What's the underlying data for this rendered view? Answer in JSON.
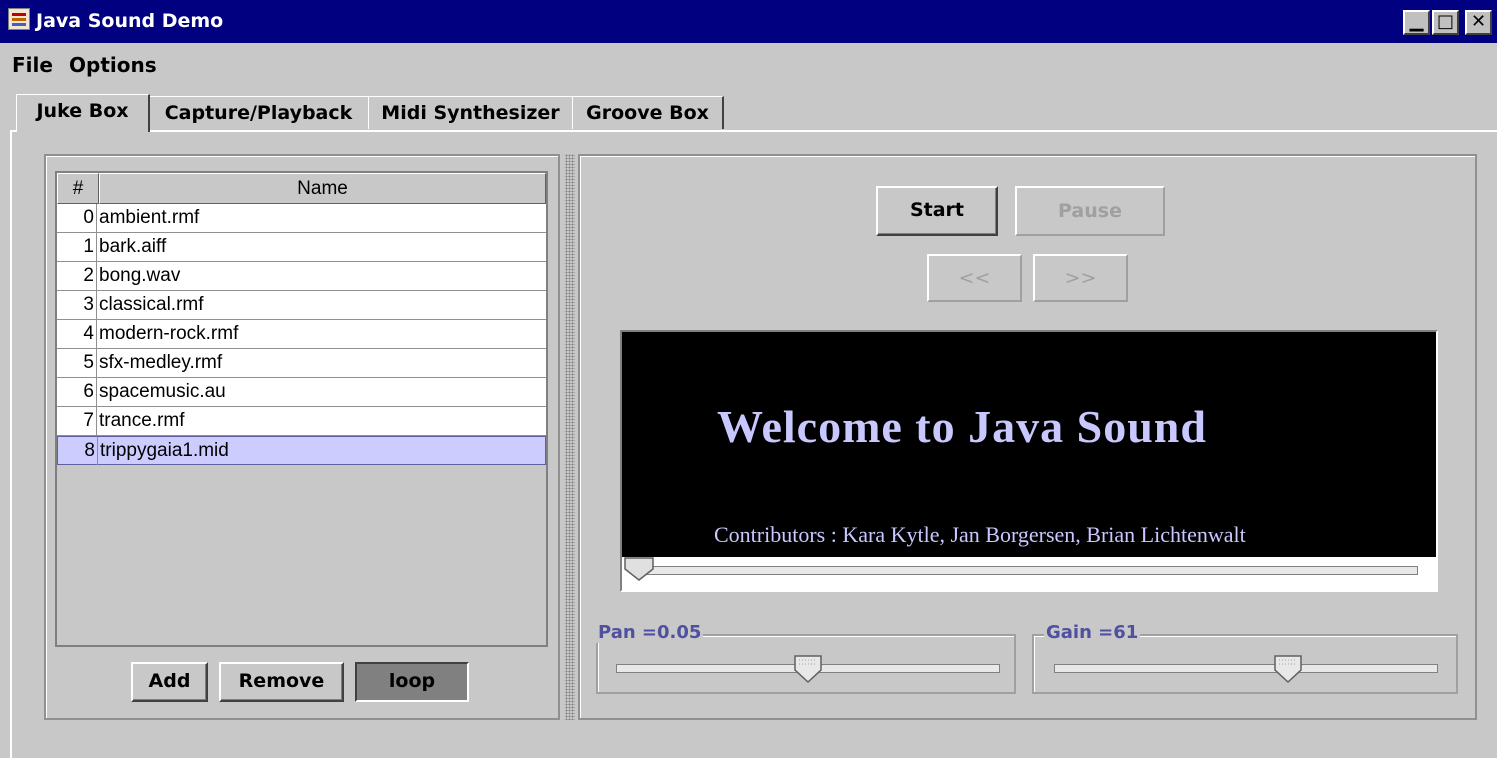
{
  "window": {
    "title": "Java Sound Demo",
    "controls": {
      "minimize": "▁",
      "maximize": "□",
      "close": "✕"
    }
  },
  "menu": {
    "items": [
      "File",
      "Options"
    ]
  },
  "tabs": [
    {
      "label": "Juke Box",
      "active": true
    },
    {
      "label": "Capture/Playback",
      "active": false
    },
    {
      "label": "Midi Synthesizer",
      "active": false
    },
    {
      "label": "Groove Box",
      "active": false
    }
  ],
  "playlist": {
    "columns": {
      "num": "#",
      "name": "Name"
    },
    "rows": [
      {
        "num": "0",
        "name": "ambient.rmf"
      },
      {
        "num": "1",
        "name": "bark.aiff"
      },
      {
        "num": "2",
        "name": "bong.wav"
      },
      {
        "num": "3",
        "name": "classical.rmf"
      },
      {
        "num": "4",
        "name": "modern-rock.rmf"
      },
      {
        "num": "5",
        "name": "sfx-medley.rmf"
      },
      {
        "num": "6",
        "name": "spacemusic.au"
      },
      {
        "num": "7",
        "name": "trance.rmf"
      },
      {
        "num": "8",
        "name": "trippygaia1.mid"
      }
    ],
    "selected_index": 8
  },
  "list_buttons": {
    "add": "Add",
    "remove": "Remove",
    "loop": "loop"
  },
  "player": {
    "start": "Start",
    "pause": "Pause",
    "prev": "<<",
    "next": ">>"
  },
  "display": {
    "welcome": "Welcome to Java Sound",
    "contributors": "Contributors : Kara Kytle, Jan Borgersen, Brian Lichtenwalt",
    "progress": 0
  },
  "pan": {
    "label": "Pan =0.05",
    "level": 0.5
  },
  "gain": {
    "label": "Gain =61",
    "level": 0.61
  },
  "colors": {
    "title_bar": "#000080",
    "selection": "#ccccff",
    "display_bg": "#000000",
    "display_text": "#c8c8ff",
    "group_label": "#5050a0"
  }
}
